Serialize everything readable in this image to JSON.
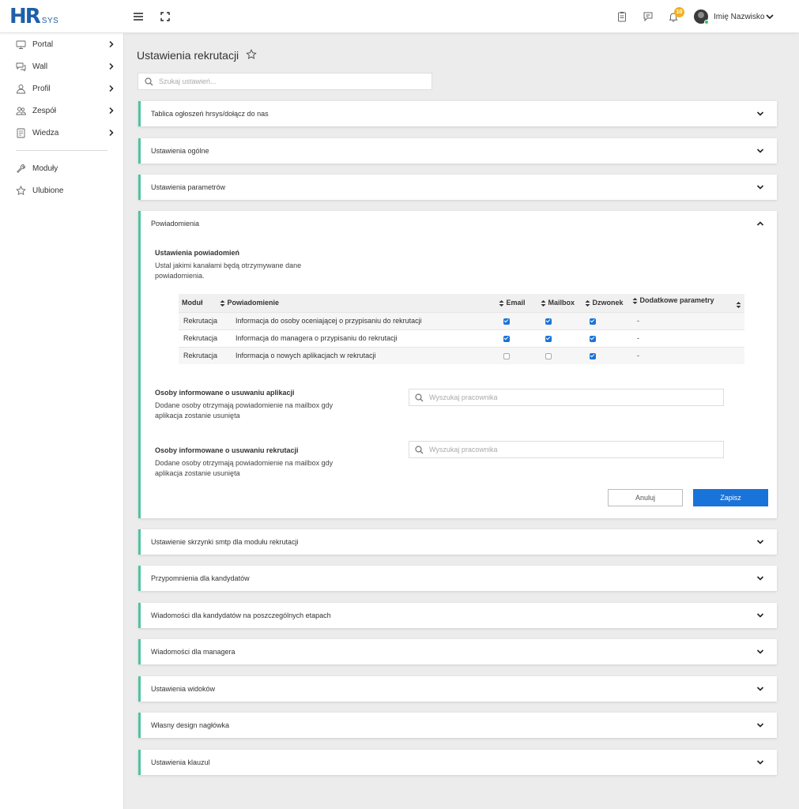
{
  "brand": {
    "logo_main": "HR",
    "logo_sub": "SYS"
  },
  "topbar": {
    "notification_count": "10",
    "user_name": "Imię Nazwisko"
  },
  "sidebar": {
    "items": [
      {
        "label": "Portal"
      },
      {
        "label": "Wall"
      },
      {
        "label": "Profil"
      },
      {
        "label": "Zespół"
      },
      {
        "label": "Wiedza"
      },
      {
        "label": "Moduły"
      },
      {
        "label": "Ulubione"
      }
    ]
  },
  "page": {
    "title": "Ustawienia rekrutacji",
    "search_placeholder": "Szukaj ustawień..."
  },
  "panels": [
    {
      "label": "Tablica ogłoszeń hrsys/dołącz do nas"
    },
    {
      "label": "Ustawienia ogólne"
    },
    {
      "label": "Ustawienia parametrów"
    },
    {
      "label": "Powiadomienia"
    },
    {
      "label": "Ustawienie skrzynki smtp dla modułu rekrutacji"
    },
    {
      "label": "Przypomnienia dla kandydatów"
    },
    {
      "label": "Wiadomości dla kandydatów na poszczególnych etapach"
    },
    {
      "label": "Wiadomości dla managera"
    },
    {
      "label": "Ustawienia widoków"
    },
    {
      "label": "Własny design nagłówka"
    },
    {
      "label": "Ustawienia klauzul"
    }
  ],
  "notifications": {
    "title": "Ustawienia powiadomień",
    "description": "Ustal jakimi kanałami będą otrzymywane dane powiadomienia.",
    "table": {
      "headers": [
        "Moduł",
        "Powiadomienie",
        "Email",
        "Mailbox",
        "Dzwonek",
        "Dodatkowe parametry"
      ],
      "rows": [
        {
          "module": "Rekrutacja",
          "notification": "Informacja do osoby oceniającej o przypisaniu do rekrutacji",
          "email": true,
          "mailbox": true,
          "bell": true,
          "extra": "-"
        },
        {
          "module": "Rekrutacja",
          "notification": "Informacja do managera o przypisaniu do rekrutacji",
          "email": true,
          "mailbox": true,
          "bell": true,
          "extra": "-"
        },
        {
          "module": "Rekrutacja",
          "notification": "Informacja o nowych aplikacjach w rekrutacji",
          "email": false,
          "mailbox": false,
          "bell": true,
          "extra": "-"
        }
      ]
    },
    "app_removal": {
      "title": "Osoby informowane o usuwaniu aplikacji",
      "description": "Dodane osoby otrzymają powiadomienie na mailbox gdy aplikacja zostanie usunięta",
      "placeholder": "Wyszukaj pracownika"
    },
    "rec_removal": {
      "title": "Osoby informowane o usuwaniu rekrutacji",
      "description": "Dodane osoby otrzymają powiadomienie na mailbox gdy aplikacja zostanie usunięta",
      "placeholder": "Wyszukaj pracownika"
    },
    "cancel_label": "Anuluj",
    "save_label": "Zapisz"
  },
  "colors": {
    "accent": "#4fc3a1",
    "primary": "#1a73d9",
    "brand": "#1f5fa8",
    "badge": "#f2b01e"
  }
}
